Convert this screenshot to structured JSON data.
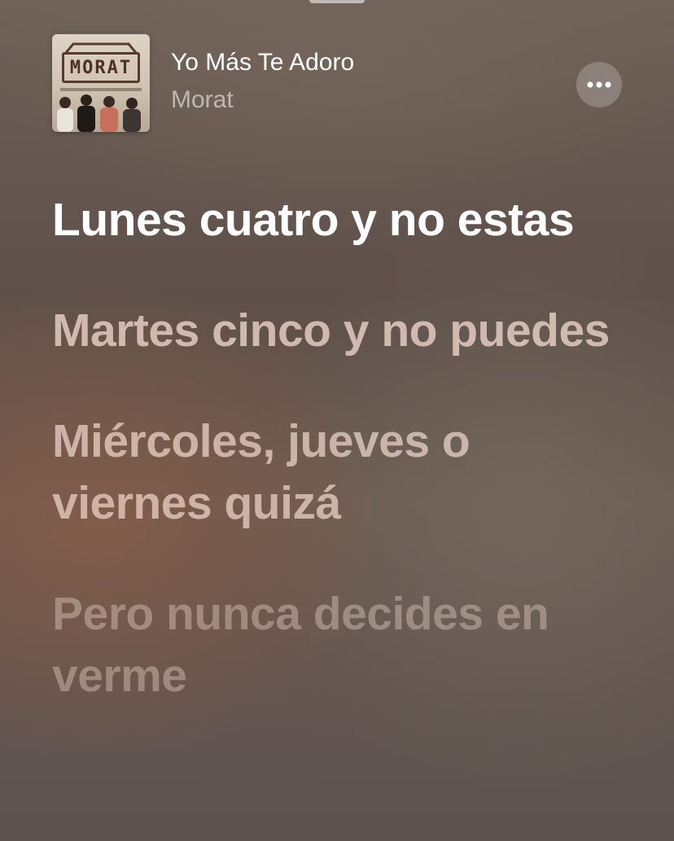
{
  "now_playing": {
    "title": "Yo Más Te Adoro",
    "artist": "Morat",
    "artwork": {
      "logo_text": "MORAT"
    },
    "more_icon": "ellipsis-icon"
  },
  "lyrics": {
    "lines": [
      {
        "text": "Lunes cuatro y no estas",
        "state": "active"
      },
      {
        "text": "Martes cinco y no puedes",
        "state": "upcoming"
      },
      {
        "text": "Miércoles, jueves o viernes quizá",
        "state": "upcoming"
      },
      {
        "text": "Pero nunca decides en verme",
        "state": "upcoming"
      }
    ]
  },
  "colors": {
    "active_lyric": "#ffffff",
    "upcoming_lyric": "#eed6cc"
  }
}
